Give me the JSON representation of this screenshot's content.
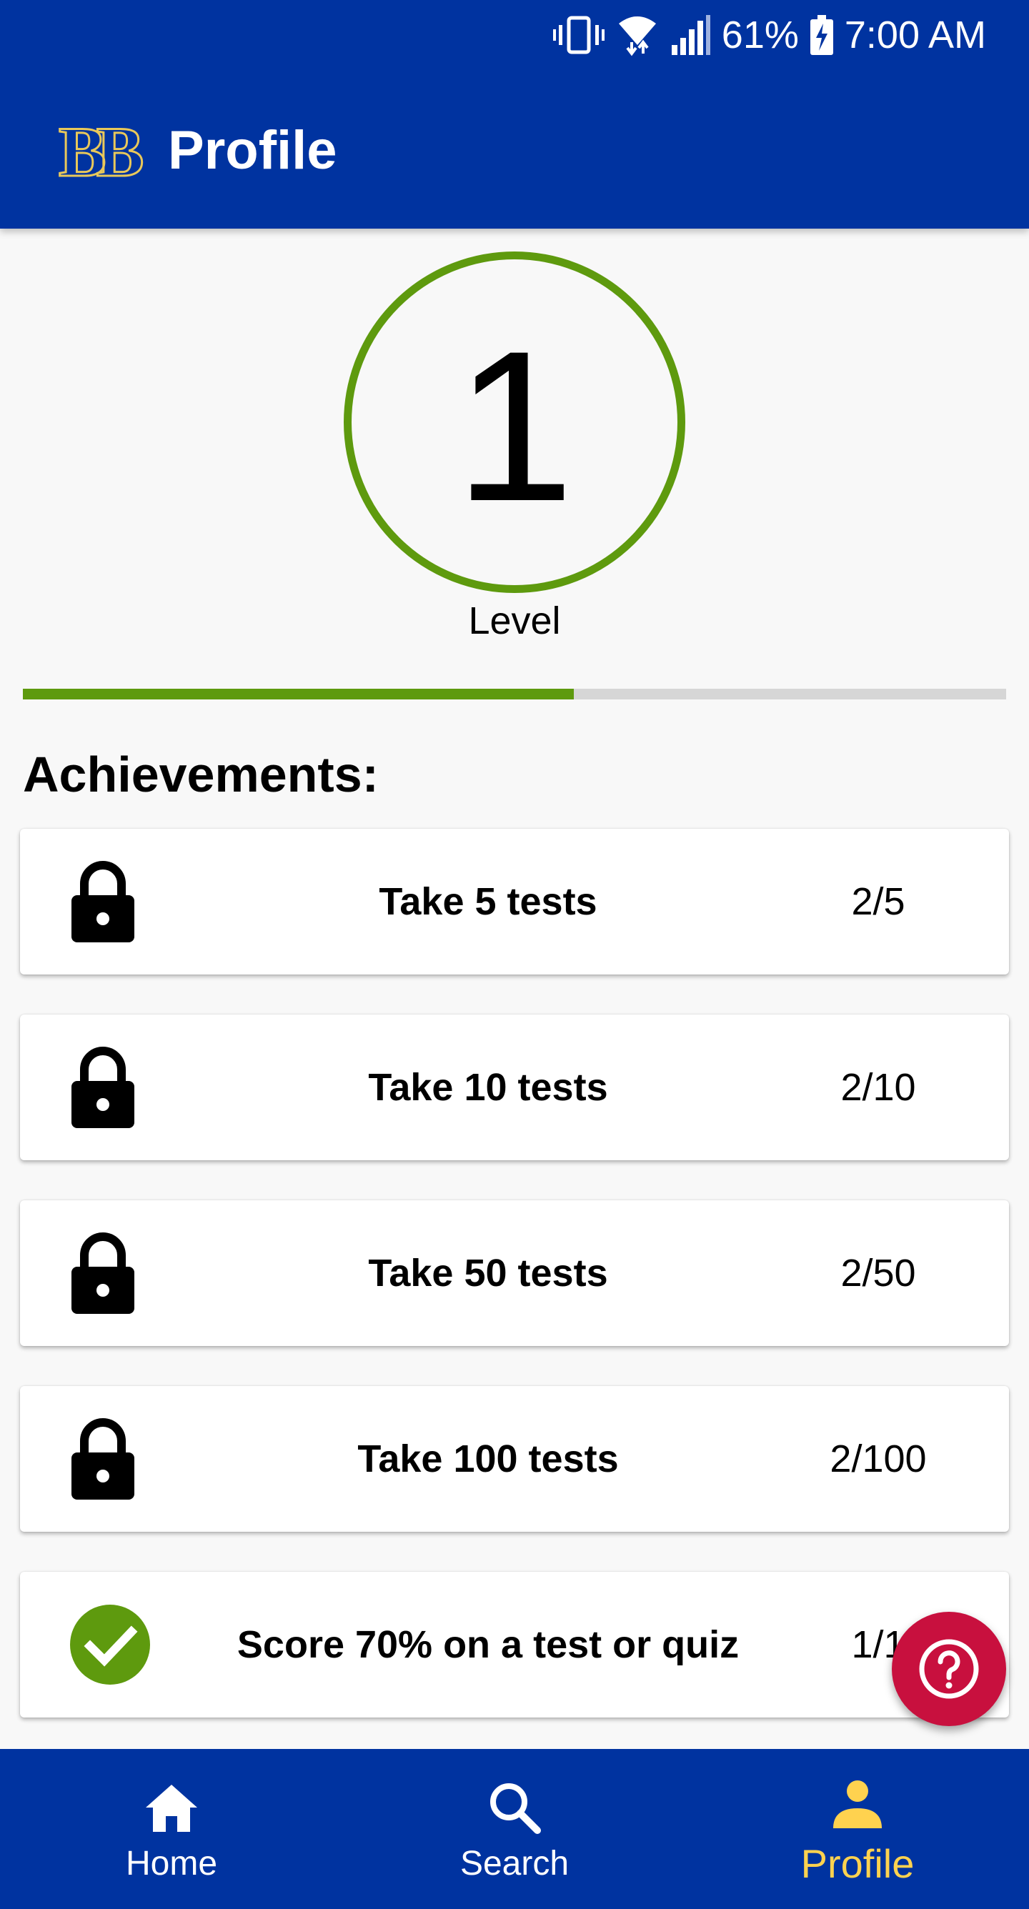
{
  "status_bar": {
    "battery": "61%",
    "time": "7:00 AM",
    "icons": [
      "vibrate-icon",
      "wifi-icon",
      "signal-icon",
      "battery-charging-icon"
    ]
  },
  "header": {
    "logo_text": "BB",
    "title": "Profile"
  },
  "level": {
    "number": "1",
    "label": "Level",
    "xp_progress_fraction": 0.56
  },
  "achievements": {
    "heading": "Achievements:",
    "items": [
      {
        "title": "Take 5 tests",
        "progress": "2/5",
        "status": "locked",
        "icon": "lock-icon"
      },
      {
        "title": "Take 10 tests",
        "progress": "2/10",
        "status": "locked",
        "icon": "lock-icon"
      },
      {
        "title": "Take 50 tests",
        "progress": "2/50",
        "status": "locked",
        "icon": "lock-icon"
      },
      {
        "title": "Take 100 tests",
        "progress": "2/100",
        "status": "locked",
        "icon": "lock-icon"
      },
      {
        "title": "Score 70% on a test or quiz",
        "progress": "1/1",
        "status": "completed",
        "icon": "check-circle-icon"
      }
    ]
  },
  "help_button": {
    "icon": "help-icon"
  },
  "bottom_nav": {
    "items": [
      {
        "label": "Home",
        "icon": "home-icon",
        "active": false
      },
      {
        "label": "Search",
        "icon": "search-icon",
        "active": false
      },
      {
        "label": "Profile",
        "icon": "person-icon",
        "active": true
      }
    ]
  },
  "colors": {
    "primary": "#0033a0",
    "accent_green": "#5e9a0e",
    "active_nav": "#ffd24f",
    "help_fab": "#c8103e"
  }
}
